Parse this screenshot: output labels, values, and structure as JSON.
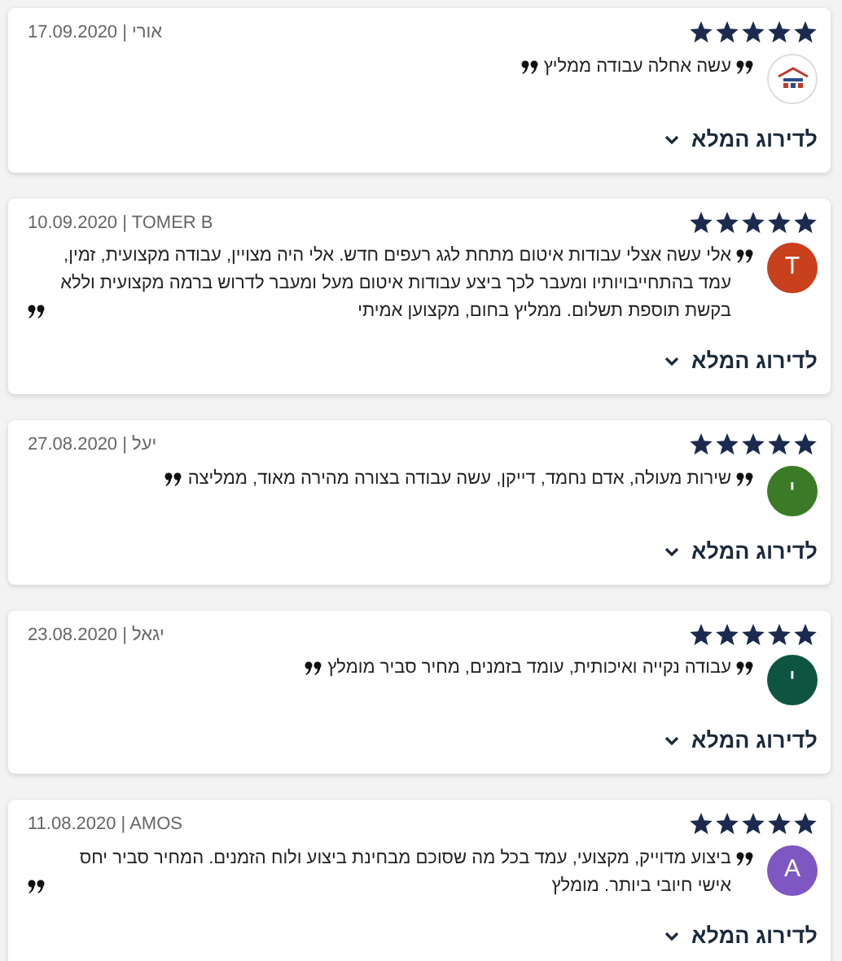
{
  "reviews": [
    {
      "stars": 5,
      "meta": "17.09.2020 | אורי",
      "avatar": {
        "kind": "logo"
      },
      "text": "עשה אחלה עבודה ממליץ",
      "link": "לדירוג המלא"
    },
    {
      "stars": 5,
      "meta": "10.09.2020 | TOMER B",
      "avatar": {
        "kind": "letter",
        "letter": "T",
        "color": "#c8401c"
      },
      "text": "אלי עשה אצלי עבודות איטום מתחת לגג רעפים חדש. אלי היה מצויין, עבודה מקצועית, זמין, עמד בהתחייבויותיו ומעבר לכך ביצע עבודות איטום מעל ומעבר לדרוש ברמה מקצועית וללא בקשת תוספת תשלום. ממליץ בחום, מקצוען אמיתי",
      "link": "לדירוג המלא"
    },
    {
      "stars": 5,
      "meta": "27.08.2020 | יעל",
      "avatar": {
        "kind": "letter",
        "letter": "י",
        "color": "#3b7a26"
      },
      "text": "שירות מעולה, אדם נחמד, דייקן, עשה עבודה בצורה מהירה מאוד, ממליצה",
      "link": "לדירוג המלא"
    },
    {
      "stars": 5,
      "meta": "23.08.2020 | יגאל",
      "avatar": {
        "kind": "letter",
        "letter": "י",
        "color": "#0e5541"
      },
      "text": "עבודה נקייה ואיכותית, עומד בזמנים, מחיר סביר מומלץ",
      "link": "לדירוג המלא"
    },
    {
      "stars": 5,
      "meta": "11.08.2020 | AMOS",
      "avatar": {
        "kind": "letter",
        "letter": "A",
        "color": "#7e57c2"
      },
      "text": "ביצוע מדוייק, מקצועי, עמד בכל מה שסוכם מבחינת ביצוע ולוח הזמנים. המחיר סביר יחס אישי חיובי ביותר. מומלץ",
      "link": "לדירוג המלא"
    }
  ]
}
